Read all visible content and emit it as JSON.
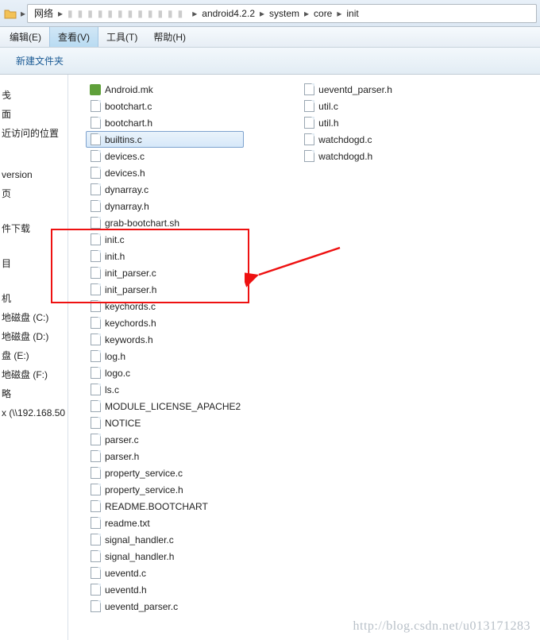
{
  "breadcrumb": {
    "root": "网络",
    "items": [
      "android4.2.2",
      "system",
      "core",
      "init"
    ]
  },
  "menu": {
    "edit": "编辑(E)",
    "view": "查看(V)",
    "tools": "工具(T)",
    "help": "帮助(H)"
  },
  "toolbar": {
    "new_folder": "新建文件夹"
  },
  "sidebar": {
    "items1": [
      "",
      "戋",
      "面"
    ],
    "recent": "近访问的位置",
    "items2": [
      "version",
      "页",
      ""
    ],
    "downloads": "件下载",
    "items3": [
      "",
      "目",
      ""
    ],
    "computer": "机",
    "drive_c": "地磁盘 (C:)",
    "drive_d": "地磁盘 (D:)",
    "drive_e": "盘 (E:)",
    "drive_f": "地磁盘 (F:)",
    "items4": [
      "略"
    ],
    "net": "x (\\\\192.168.50"
  },
  "files_col1": [
    {
      "name": "Android.mk",
      "icon": "mk"
    },
    {
      "name": "bootchart.c",
      "icon": "doc"
    },
    {
      "name": "bootchart.h",
      "icon": "doc"
    },
    {
      "name": "builtins.c",
      "icon": "doc",
      "selected": true
    },
    {
      "name": "devices.c",
      "icon": "doc"
    },
    {
      "name": "devices.h",
      "icon": "doc"
    },
    {
      "name": "dynarray.c",
      "icon": "doc"
    },
    {
      "name": "dynarray.h",
      "icon": "doc"
    },
    {
      "name": "grab-bootchart.sh",
      "icon": "doc"
    },
    {
      "name": "init.c",
      "icon": "doc"
    },
    {
      "name": "init.h",
      "icon": "doc"
    },
    {
      "name": "init_parser.c",
      "icon": "doc"
    },
    {
      "name": "init_parser.h",
      "icon": "doc"
    },
    {
      "name": "keychords.c",
      "icon": "doc"
    },
    {
      "name": "keychords.h",
      "icon": "doc"
    },
    {
      "name": "keywords.h",
      "icon": "doc"
    },
    {
      "name": "log.h",
      "icon": "doc"
    },
    {
      "name": "logo.c",
      "icon": "doc"
    },
    {
      "name": "ls.c",
      "icon": "doc"
    },
    {
      "name": "MODULE_LICENSE_APACHE2",
      "icon": "doc"
    },
    {
      "name": "NOTICE",
      "icon": "doc"
    },
    {
      "name": "parser.c",
      "icon": "doc"
    },
    {
      "name": "parser.h",
      "icon": "doc"
    },
    {
      "name": "property_service.c",
      "icon": "doc"
    },
    {
      "name": "property_service.h",
      "icon": "doc"
    },
    {
      "name": "README.BOOTCHART",
      "icon": "doc"
    },
    {
      "name": "readme.txt",
      "icon": "doc"
    },
    {
      "name": "signal_handler.c",
      "icon": "doc"
    },
    {
      "name": "signal_handler.h",
      "icon": "doc"
    },
    {
      "name": "ueventd.c",
      "icon": "doc"
    },
    {
      "name": "ueventd.h",
      "icon": "doc"
    },
    {
      "name": "ueventd_parser.c",
      "icon": "doc"
    }
  ],
  "files_col2": [
    {
      "name": "ueventd_parser.h",
      "icon": "doc"
    },
    {
      "name": "util.c",
      "icon": "doc"
    },
    {
      "name": "util.h",
      "icon": "doc"
    },
    {
      "name": "watchdogd.c",
      "icon": "doc"
    },
    {
      "name": "watchdogd.h",
      "icon": "doc"
    }
  ],
  "watermark": "http://blog.csdn.net/u013171283"
}
